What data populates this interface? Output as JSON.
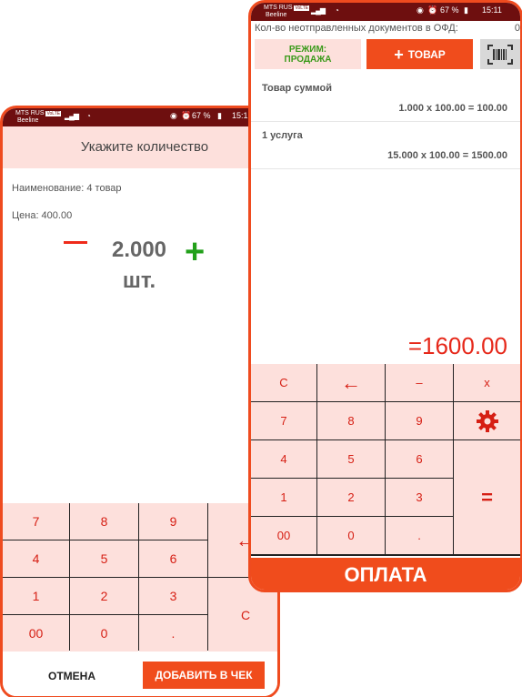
{
  "status_left": {
    "carrier_top": "MTS RUS",
    "carrier_badge": "VoLTE",
    "carrier_bottom": "Beeline",
    "battery": "67 %",
    "time": "15:1"
  },
  "status_right": {
    "carrier_top": "MTS RUS",
    "carrier_badge": "VoLTE",
    "carrier_bottom": "Beeline",
    "battery": "67 %",
    "time": "15:11"
  },
  "quantity_dialog": {
    "title": "Укажите количество",
    "name_line": "Наименование: 4 товар",
    "price_line": "Цена: 400.00",
    "quantity": "2.000",
    "unit": "шт.",
    "minus_icon": "minus-icon",
    "plus_icon": "plus-icon",
    "keypad": {
      "k7": "7",
      "k8": "8",
      "k9": "9",
      "k4": "4",
      "k5": "5",
      "k6": "6",
      "k1": "1",
      "k2": "2",
      "k3": "3",
      "k00": "00",
      "k0": "0",
      "kdot": ".",
      "backspace": "←",
      "clear": "С"
    },
    "cancel_label": "ОТМЕНА",
    "add_label": "ДОБАВИТЬ В ЧЕК"
  },
  "cashier": {
    "ofd_label": "Кол-во неотправленных документов в ОФД:",
    "ofd_count": "0",
    "mode_line1": "РЕЖИМ:",
    "mode_line2": "ПРОДАЖА",
    "add_item_label": "ТОВАР",
    "scan_icon": "barcode-scan-icon",
    "items": [
      {
        "name": "Товар суммой",
        "calc": "1.000 x 100.00 = 100.00"
      },
      {
        "name": "1 услуга",
        "calc": "15.000 x 100.00 = 1500.00"
      }
    ],
    "total": "=1600.00",
    "keypad": {
      "clear": "С",
      "backspace": "←",
      "minus": "–",
      "multiply": "x",
      "k7": "7",
      "k8": "8",
      "k9": "9",
      "settings_icon": "gear-icon",
      "k4": "4",
      "k5": "5",
      "k6": "6",
      "k1": "1",
      "k2": "2",
      "k3": "3",
      "equals": "=",
      "k00": "00",
      "k0": "0",
      "kdot": "."
    },
    "pay_label": "ОПЛАТА"
  },
  "colors": {
    "accent": "#f04c1c",
    "key_bg": "#fde0dc",
    "key_text": "#d61f14",
    "status_bar": "#6e0f0f",
    "plus": "#22a01a"
  }
}
